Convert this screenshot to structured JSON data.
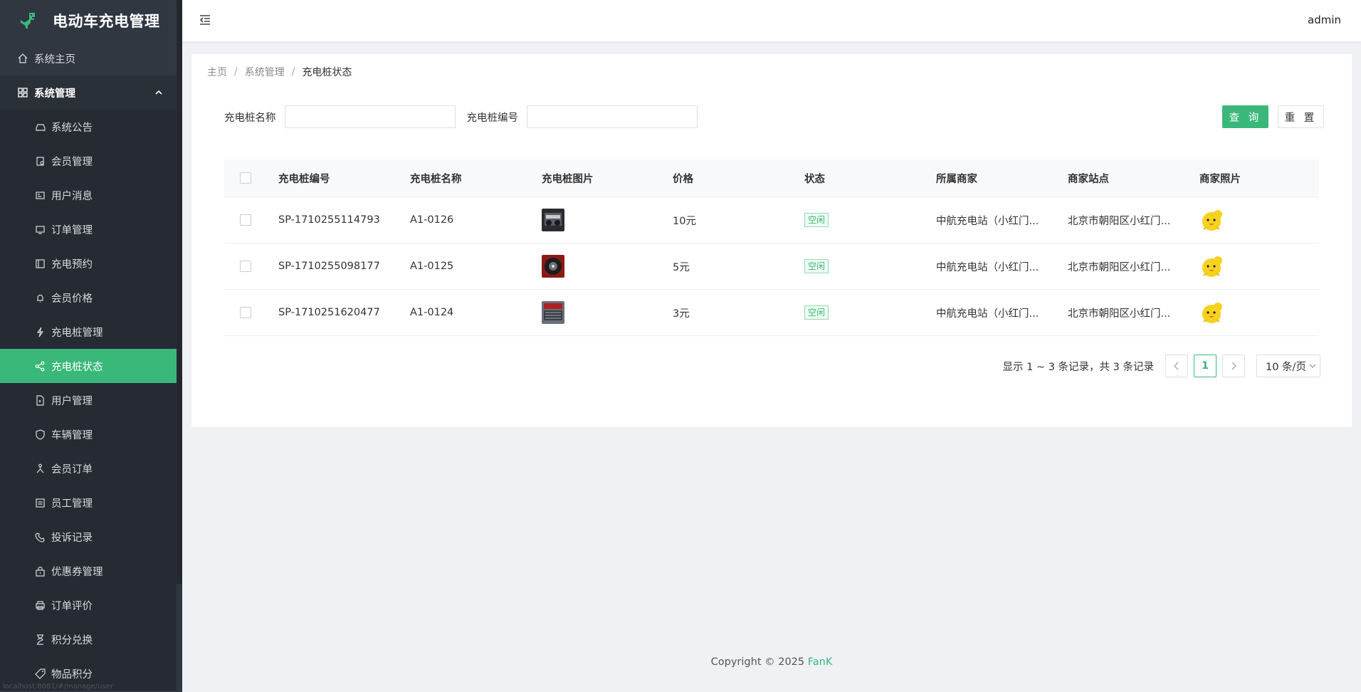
{
  "app": {
    "title": "电动车充电管理"
  },
  "sidebar": {
    "home": "系统主页",
    "group": "系统管理",
    "items": [
      {
        "label": "系统公告",
        "icon": "car-icon"
      },
      {
        "label": "会员管理",
        "icon": "document-icon"
      },
      {
        "label": "用户消息",
        "icon": "id-card-icon"
      },
      {
        "label": "订单管理",
        "icon": "monitor-icon"
      },
      {
        "label": "充电预约",
        "icon": "calendar-icon"
      },
      {
        "label": "会员价格",
        "icon": "bell-icon"
      },
      {
        "label": "充电桩管理",
        "icon": "lightning-icon"
      },
      {
        "label": "充电桩状态",
        "icon": "share-icon",
        "active": true
      },
      {
        "label": "用户管理",
        "icon": "file-icon"
      },
      {
        "label": "车辆管理",
        "icon": "shield-icon"
      },
      {
        "label": "会员订单",
        "icon": "network-icon"
      },
      {
        "label": "员工管理",
        "icon": "list-icon"
      },
      {
        "label": "投诉记录",
        "icon": "phone-icon"
      },
      {
        "label": "优惠券管理",
        "icon": "lock-icon"
      },
      {
        "label": "订单评价",
        "icon": "printer-icon"
      },
      {
        "label": "积分兑换",
        "icon": "hourglass-icon"
      },
      {
        "label": "物品积分",
        "icon": "tag-icon"
      }
    ],
    "url_hint": "localhost:8081/#/manage/user"
  },
  "header": {
    "user": "admin"
  },
  "breadcrumb": {
    "home": "主页",
    "section": "系统管理",
    "current": "充电桩状态",
    "sep": "/"
  },
  "search": {
    "name_label": "充电桩名称",
    "code_label": "充电桩编号",
    "name_value": "",
    "code_value": "",
    "query_button": "查 询",
    "reset_button": "重 置"
  },
  "table": {
    "headers": [
      "充电桩编号",
      "充电桩名称",
      "充电桩图片",
      "价格",
      "状态",
      "所属商家",
      "商家站点",
      "商家照片"
    ],
    "rows": [
      {
        "code": "SP-1710255114793",
        "name": "A1-0126",
        "price": "10元",
        "status": "空闲",
        "merchant": "中航充电站（小红门...",
        "site": "北京市朝阳区小红门..."
      },
      {
        "code": "SP-1710255098177",
        "name": "A1-0125",
        "price": "5元",
        "status": "空闲",
        "merchant": "中航充电站（小红门...",
        "site": "北京市朝阳区小红门..."
      },
      {
        "code": "SP-1710251620477",
        "name": "A1-0124",
        "price": "3元",
        "status": "空闲",
        "merchant": "中航充电站（小红门...",
        "site": "北京市朝阳区小红门..."
      }
    ]
  },
  "pagination": {
    "info": "显示 1 ~ 3 条记录，共 3 条记录",
    "current_page": "1",
    "page_size": "10 条/页"
  },
  "footer": {
    "copyright": "Copyright © 2025 ",
    "brand": "FanK"
  },
  "colors": {
    "accent": "#3ab87a",
    "sidebar_bg": "#303741"
  }
}
